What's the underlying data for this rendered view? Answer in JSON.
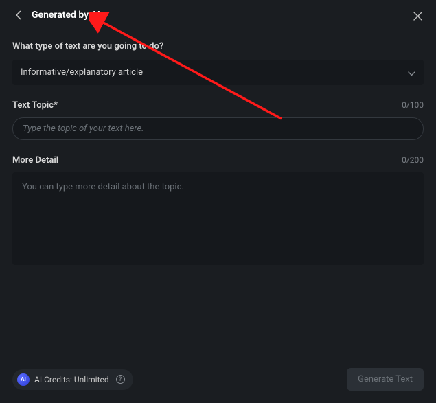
{
  "header": {
    "title": "Generated by AI"
  },
  "fields": {
    "textType": {
      "label": "What type of text are you going to do?",
      "selected": "Informative/explanatory article"
    },
    "topic": {
      "label": "Text Topic*",
      "placeholder": "Type the topic of your text here.",
      "value": "",
      "count": "0/100"
    },
    "detail": {
      "label": "More Detail",
      "placeholder": "You can type more detail about the topic.",
      "value": "",
      "count": "0/200"
    }
  },
  "footer": {
    "creditsLabel": "AI Credits: Unlimited",
    "aiBadge": "AI",
    "generateLabel": "Generate Text"
  },
  "annotation": {
    "color": "#ff1a1a"
  }
}
